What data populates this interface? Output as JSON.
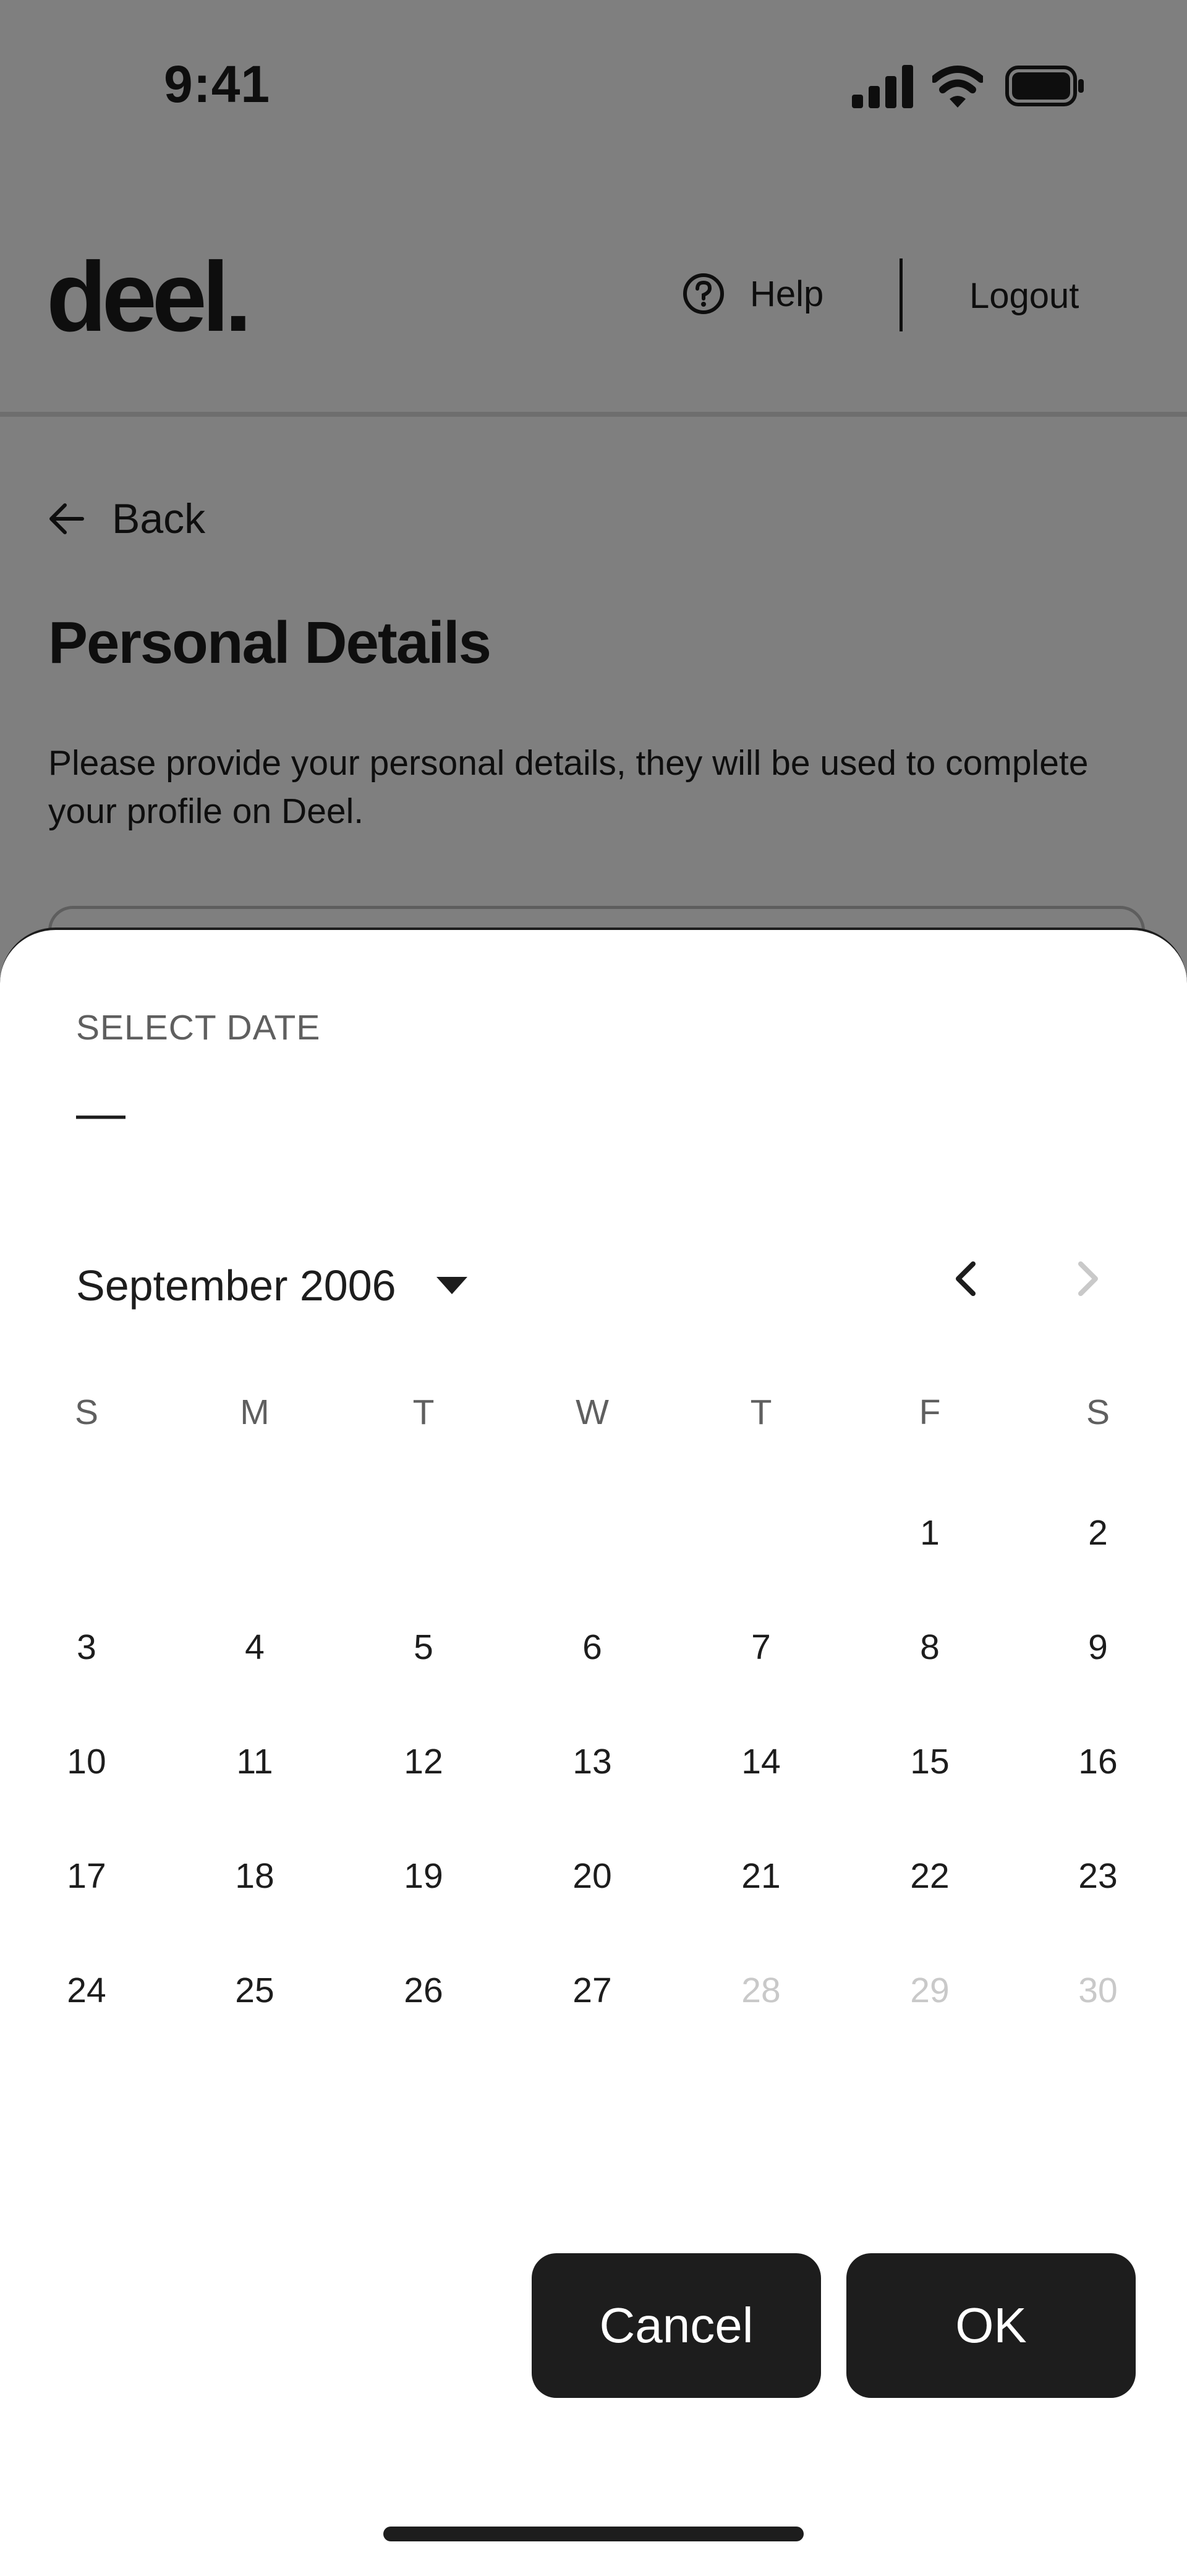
{
  "status_bar": {
    "time": "9:41"
  },
  "header": {
    "logo": "deel.",
    "help_label": "Help",
    "logout_label": "Logout"
  },
  "content": {
    "back_label": "Back",
    "title": "Personal Details",
    "description": "Please provide your personal details, they will be used to complete your profile on Deel."
  },
  "date_picker": {
    "label": "SELECT DATE",
    "selected_value": "—",
    "month_label": "September 2006",
    "weekdays": [
      "S",
      "M",
      "T",
      "W",
      "T",
      "F",
      "S"
    ],
    "weeks": [
      [
        "",
        "",
        "",
        "",
        "",
        "1",
        "2"
      ],
      [
        "3",
        "4",
        "5",
        "6",
        "7",
        "8",
        "9"
      ],
      [
        "10",
        "11",
        "12",
        "13",
        "14",
        "15",
        "16"
      ],
      [
        "17",
        "18",
        "19",
        "20",
        "21",
        "22",
        "23"
      ],
      [
        "24",
        "25",
        "26",
        "27",
        "28",
        "29",
        "30"
      ]
    ],
    "disabled_days": [
      "28",
      "29",
      "30"
    ],
    "cancel_label": "Cancel",
    "ok_label": "OK"
  },
  "icons": {
    "help": "help-circle-icon",
    "back": "arrow-left-icon",
    "month_dropdown": "caret-down-icon",
    "prev_month": "chevron-left-icon",
    "next_month": "chevron-right-icon"
  },
  "colors": {
    "primary": "#1d1d1d",
    "muted_text": "#5f5f5f",
    "disabled_text": "#c9c9c9",
    "overlay": "rgba(0,0,0,0.5)"
  }
}
